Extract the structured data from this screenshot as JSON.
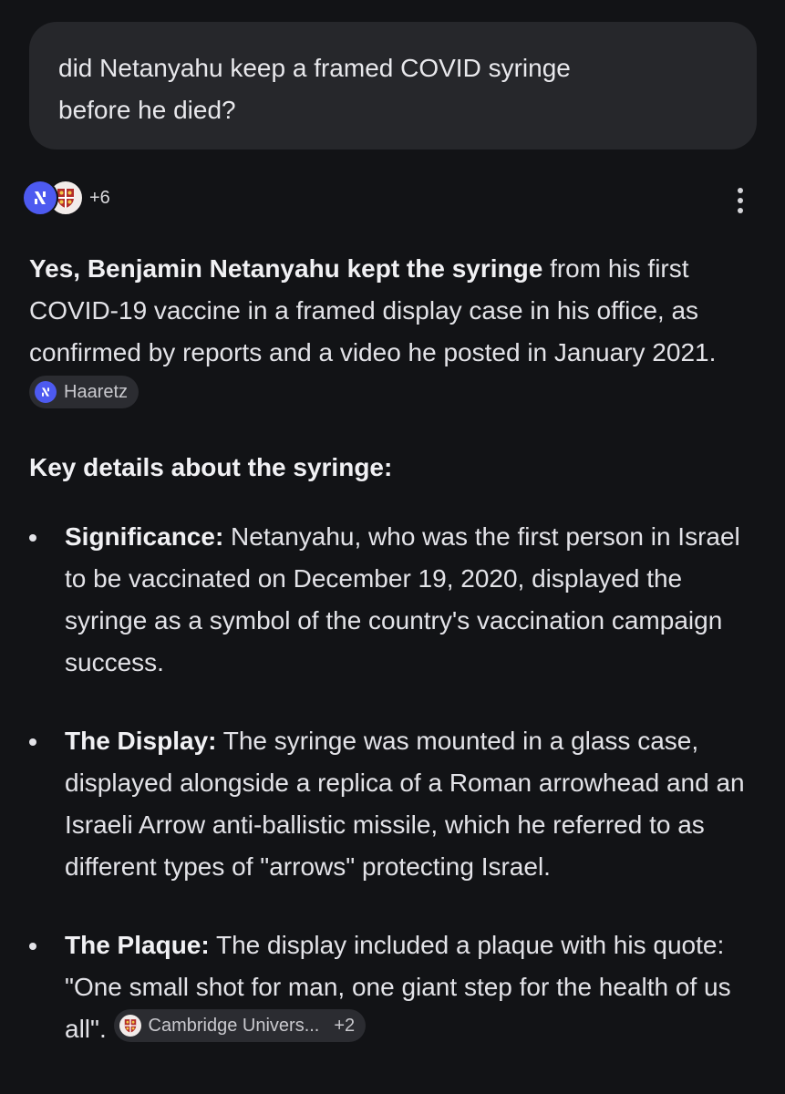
{
  "query": {
    "line1": "did Netanyahu keep a framed COVID syringe",
    "line2": "before he died?"
  },
  "sources": {
    "extra_count": "+6"
  },
  "intro": {
    "bold": "Yes, Benjamin Netanyahu kept the syringe",
    "text": " from his first COVID-19 vaccine in a framed display case in his office, as confirmed by reports and a video he posted in January 2021. ",
    "chip_label": "Haaretz"
  },
  "heading": "Key details about the syringe:",
  "bullets": [
    {
      "label": "Significance:",
      "text": " Netanyahu, who was the first person in Israel to be vaccinated on December 19, 2020, displayed the syringe as a symbol of the country's vaccination campaign success."
    },
    {
      "label": "The Display:",
      "text": " The syringe was mounted in a glass case, displayed alongside a replica of a Roman arrowhead and an Israeli Arrow anti-ballistic missile, which he referred to as different types of \"arrows\" protecting Israel."
    },
    {
      "label": "The Plaque:",
      "text": " The display included a plaque with his quote: \"One small shot for man, one giant step for the health of us all\". ",
      "chip_label": "Cambridge Univers...",
      "chip_extra": "+2"
    }
  ],
  "icons": {
    "haaretz": "haaretz-logo-icon",
    "cambridge": "cambridge-shield-icon",
    "menu": "more-vert-icon"
  },
  "colors": {
    "background": "#121316",
    "bubble": "#26272b",
    "chip": "#2b2c31",
    "haaretz_brand": "#4d5af0"
  }
}
